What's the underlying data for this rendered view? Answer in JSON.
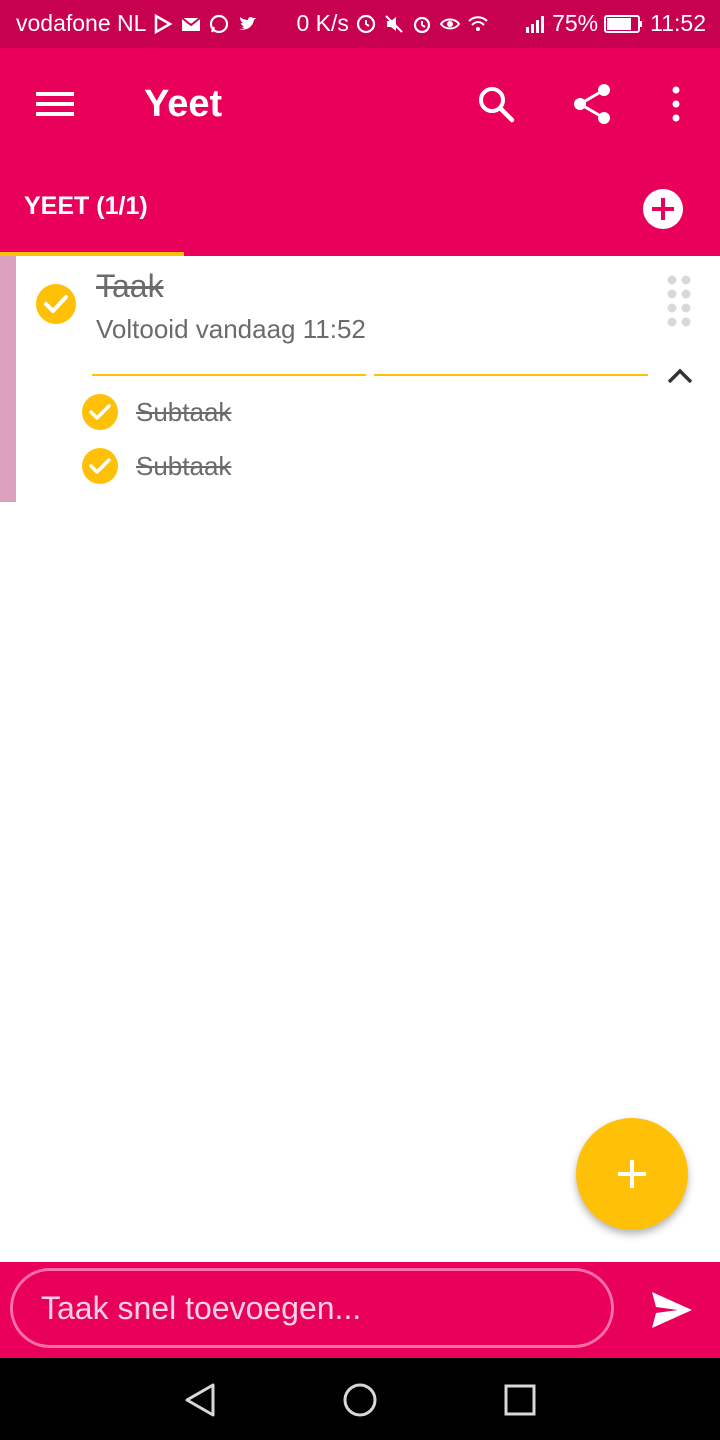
{
  "status_bar": {
    "carrier": "vodafone NL",
    "net_speed": "0 K/s",
    "battery": "75%",
    "time": "11:52"
  },
  "toolbar": {
    "title": "Yeet",
    "icons": [
      "menu-icon",
      "search-icon",
      "share-icon",
      "more-vert-icon"
    ]
  },
  "tabs": [
    {
      "label": "YEET (1/1)"
    }
  ],
  "task": {
    "title": "Taak",
    "completed_text": "Voltooid vandaag 11:52",
    "subtasks": [
      {
        "label": "Subtaak"
      },
      {
        "label": "Subtaak"
      }
    ]
  },
  "quick_add": {
    "placeholder": "Taak snel toevoegen..."
  },
  "colors": {
    "primary": "#e8005a",
    "status_bar": "#c7004f",
    "accent": "#ffc107",
    "list_stripe": "#dba1bf",
    "text_muted": "#6b6b6b"
  }
}
